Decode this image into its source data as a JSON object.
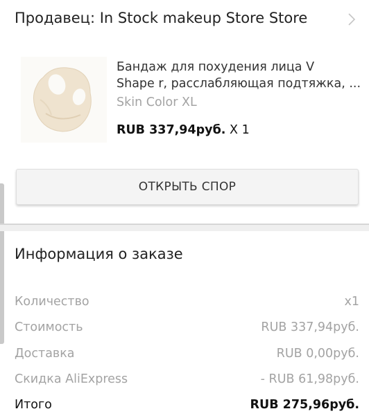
{
  "seller": {
    "label": "Продавец: In Stock makeup Store Store"
  },
  "product": {
    "title_line1": "Бандаж для похудения лица V",
    "title_line2": "Shape r, расслабляющая подтяжка, ...",
    "variant": "Skin Color XL",
    "price": "RUB 337,94руб.",
    "quantity": "X 1",
    "image_icon": "face-bandage-product-image"
  },
  "dispute_button": {
    "label": "ОТКРЫТЬ СПОР"
  },
  "order_info": {
    "title": "Информация о заказе",
    "rows": [
      {
        "label": "Количество",
        "value": "x1"
      },
      {
        "label": "Стоимость",
        "value": "RUB 337,94руб."
      },
      {
        "label": "Доставка",
        "value": "RUB 0,00руб."
      },
      {
        "label": "Скидка AliExpress",
        "value": "- RUB 61,98руб."
      },
      {
        "label": "Итого",
        "value": "RUB 275,96руб."
      }
    ]
  },
  "colors": {
    "text_primary": "#222222",
    "text_muted": "#a3a3a3",
    "button_bg": "#f4f4f4"
  }
}
